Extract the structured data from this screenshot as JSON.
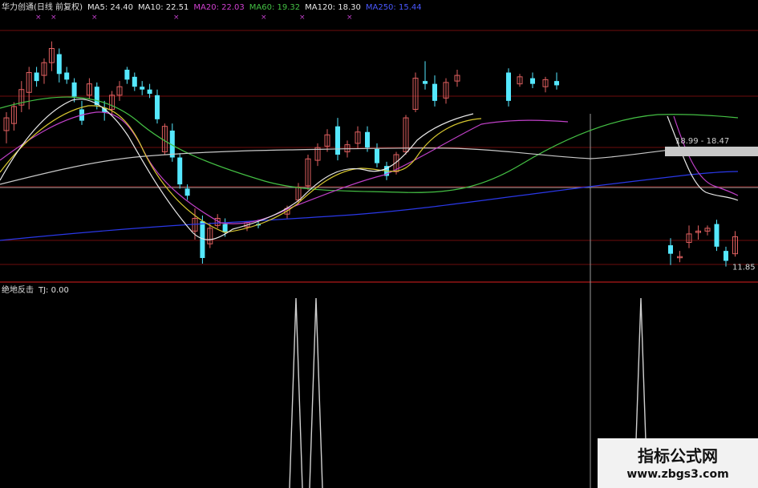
{
  "header": {
    "title": "华力创通(日线 前复权)",
    "ma5": "MA5: 24.40",
    "ma10": "MA10: 22.51",
    "ma20": "MA20: 22.03",
    "ma60": "MA60: 19.32",
    "ma120": "MA120: 18.30",
    "ma250": "MA250: 15.44"
  },
  "indicator": {
    "name": "绝地反击",
    "tj": "TJ: 0.00"
  },
  "watermark": {
    "title": "指标公式网",
    "url": "www.zbgs3.com"
  },
  "colors": {
    "background": "#000000",
    "up": "#e06060",
    "down": "#55e8ff",
    "ma5": "#e8e8e8",
    "ma10": "#d8c830",
    "ma20": "#c040c8",
    "ma60": "#44c044",
    "ma120": "#c8c8c8",
    "ma250": "#2a38e8",
    "grid": "#6e0c0c",
    "crosshair": "#9a9a9a",
    "signal": "#d0d0d0"
  },
  "chart_data": [
    {
      "type": "candlestick",
      "title": "华力创通(日线 前复权)",
      "ylim": [
        10.8,
        28.8
      ],
      "candles": [
        {
          "o": 21.5,
          "h": 22.8,
          "l": 20.6,
          "c": 22.4
        },
        {
          "o": 22.0,
          "h": 23.5,
          "l": 21.5,
          "c": 23.2
        },
        {
          "o": 23.3,
          "h": 25.0,
          "l": 22.8,
          "c": 24.4
        },
        {
          "o": 24.2,
          "h": 26.0,
          "l": 23.0,
          "c": 25.6
        },
        {
          "o": 25.6,
          "h": 26.0,
          "l": 24.6,
          "c": 25.0
        },
        {
          "o": 25.4,
          "h": 26.6,
          "l": 24.8,
          "c": 26.3
        },
        {
          "o": 26.3,
          "h": 27.8,
          "l": 25.7,
          "c": 27.3
        },
        {
          "o": 26.9,
          "h": 27.3,
          "l": 24.9,
          "c": 25.5
        },
        {
          "o": 25.6,
          "h": 26.0,
          "l": 24.8,
          "c": 25.1
        },
        {
          "o": 24.9,
          "h": 25.2,
          "l": 23.5,
          "c": 23.9
        },
        {
          "o": 23.0,
          "h": 23.6,
          "l": 21.9,
          "c": 22.2
        },
        {
          "o": 24.0,
          "h": 25.2,
          "l": 23.7,
          "c": 24.8
        },
        {
          "o": 24.6,
          "h": 24.9,
          "l": 23.0,
          "c": 23.3
        },
        {
          "o": 23.1,
          "h": 23.6,
          "l": 22.2,
          "c": 22.8
        },
        {
          "o": 23.0,
          "h": 24.3,
          "l": 22.6,
          "c": 24.0
        },
        {
          "o": 24.0,
          "h": 25.0,
          "l": 23.6,
          "c": 24.6
        },
        {
          "o": 25.8,
          "h": 26.0,
          "l": 24.8,
          "c": 25.1
        },
        {
          "o": 25.3,
          "h": 25.6,
          "l": 24.3,
          "c": 24.6
        },
        {
          "o": 24.6,
          "h": 25.0,
          "l": 24.0,
          "c": 24.4
        },
        {
          "o": 24.4,
          "h": 24.8,
          "l": 23.8,
          "c": 24.1
        },
        {
          "o": 24.0,
          "h": 24.4,
          "l": 22.0,
          "c": 22.3
        },
        {
          "o": 20.0,
          "h": 22.0,
          "l": 19.8,
          "c": 21.8
        },
        {
          "o": 21.5,
          "h": 22.0,
          "l": 19.3,
          "c": 19.6
        },
        {
          "o": 19.6,
          "h": 19.9,
          "l": 17.4,
          "c": 17.7
        },
        {
          "o": 17.4,
          "h": 17.7,
          "l": 16.6,
          "c": 16.9
        },
        {
          "o": 14.4,
          "h": 16.0,
          "l": 13.8,
          "c": 15.3
        },
        {
          "o": 15.1,
          "h": 15.5,
          "l": 12.1,
          "c": 12.5
        },
        {
          "o": 13.5,
          "h": 15.0,
          "l": 13.2,
          "c": 14.6
        },
        {
          "o": 14.8,
          "h": 15.6,
          "l": 14.6,
          "c": 15.3
        },
        {
          "o": 14.9,
          "h": 15.3,
          "l": 14.0,
          "c": 14.3
        },
        {
          "o": 13.4,
          "h": 13.9,
          "l": 12.0,
          "c": 12.8
        },
        {
          "o": 12.6,
          "h": 13.0,
          "l": 12.2,
          "c": 12.6
        },
        {
          "o": 13.6,
          "h": 14.8,
          "l": 13.2,
          "c": 14.2
        },
        {
          "o": 14.3,
          "h": 14.8,
          "l": 13.8,
          "c": 14.4
        },
        {
          "o": 14.4,
          "h": 14.8,
          "l": 14.1,
          "c": 14.6
        },
        {
          "o": 14.9,
          "h": 15.2,
          "l": 13.0,
          "c": 13.3
        },
        {
          "o": 13.0,
          "h": 13.3,
          "l": 11.9,
          "c": 12.3
        },
        {
          "o": 12.8,
          "h": 14.4,
          "l": 12.6,
          "c": 14.0
        }
      ]
    },
    {
      "type": "line",
      "title": "绝地反击",
      "ylim": [
        0,
        1
      ],
      "x": [
        "2018-03-19",
        "2018-03-21",
        "2018-07-20"
      ],
      "series": [
        {
          "name": "TJ",
          "values": [
            1,
            1,
            1
          ]
        }
      ]
    }
  ]
}
